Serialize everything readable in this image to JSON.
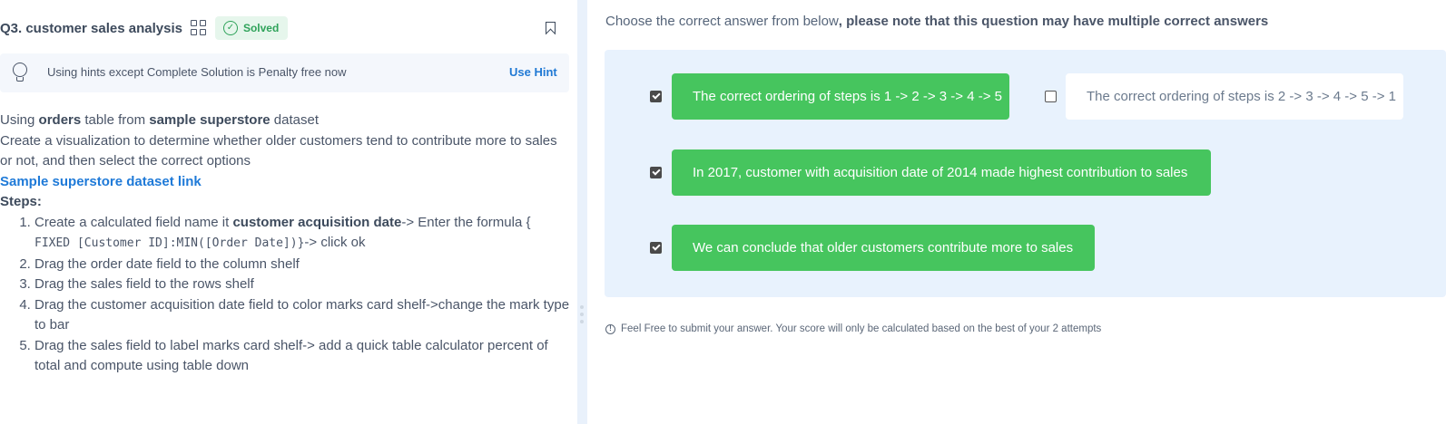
{
  "question": {
    "title": "Q3. customer sales analysis",
    "status_badge": "Solved"
  },
  "hint": {
    "text": "Using hints except Complete Solution is Penalty free now",
    "button_label": "Use Hint"
  },
  "description": {
    "line1_prefix": "Using ",
    "line1_table": "orders",
    "line1_mid": " table from ",
    "line1_dataset": "sample superstore",
    "line1_suffix": " dataset",
    "line2": "Create a visualization to determine whether older customers tend to contribute more to sales or not, and then select the correct options",
    "link_text": "Sample superstore dataset link",
    "steps_label": "Steps:",
    "step1_prefix": "Create a calculated field name it ",
    "step1_bold": "customer acquisition date",
    "step1_mid": "-> Enter the formula {",
    "step1_code": "FIXED [Customer ID]:MIN([Order Date])}",
    "step1_suffix": "-> click ok",
    "step2": "Drag the order date field to the column shelf",
    "step3": "Drag the sales field to the rows shelf",
    "step4": "Drag the customer acquisition date field to color marks card shelf->change the mark type to bar",
    "step5": "Drag the sales field to label marks card shelf-> add a quick table calculator percent of total and compute using table down"
  },
  "answers": {
    "instruction_prefix": "Choose the correct answer from below",
    "instruction_bold": ", please note that this question may have multiple correct answers",
    "options": [
      {
        "label": "The correct ordering of steps is 1 -> 2 -> 3 -> 4 -> 5",
        "checked": true
      },
      {
        "label": "The correct ordering of steps is 2 -> 3 -> 4 -> 5 -> 1",
        "checked": false
      },
      {
        "label": "In 2017, customer with acquisition date of 2014 made highest contribution to sales",
        "checked": true
      },
      {
        "label": "We can conclude that older customers contribute more to sales",
        "checked": true
      }
    ],
    "note": "Feel Free to submit your answer. Your score will only be calculated based on the best of your 2 attempts"
  },
  "colors": {
    "selected_option": "#46c55e",
    "option_panel_bg": "#e8f2fd",
    "link": "#1f7ad8",
    "solved_badge_bg": "#e6f6ec",
    "solved_badge_text": "#2fa35a"
  },
  "icons": [
    "grid-icon",
    "check-circle-icon",
    "bookmark-icon",
    "lightbulb-icon",
    "info-icon",
    "drag-handle-icon"
  ]
}
